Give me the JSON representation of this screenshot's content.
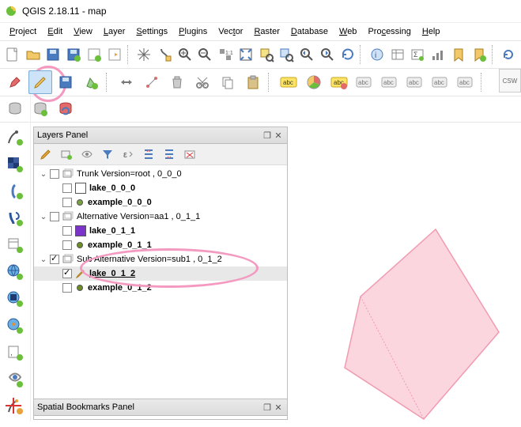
{
  "window": {
    "title": "QGIS 2.18.11 - map"
  },
  "menu": [
    {
      "label": "Project",
      "u": 0
    },
    {
      "label": "Edit",
      "u": 0
    },
    {
      "label": "View",
      "u": 0
    },
    {
      "label": "Layer",
      "u": 0
    },
    {
      "label": "Settings",
      "u": 0
    },
    {
      "label": "Plugins",
      "u": 0
    },
    {
      "label": "Vector",
      "u": 3
    },
    {
      "label": "Raster",
      "u": 0
    },
    {
      "label": "Database",
      "u": 0
    },
    {
      "label": "Web",
      "u": 0
    },
    {
      "label": "Processing",
      "u": 3
    },
    {
      "label": "Help",
      "u": 0
    }
  ],
  "panels": {
    "layers_title": "Layers Panel",
    "bookmarks_title": "Spatial Bookmarks Panel"
  },
  "layer_toolbar_icons": [
    "style",
    "add-group",
    "visibility",
    "filter",
    "expression",
    "expand-all",
    "collapse-all",
    "remove"
  ],
  "tree": {
    "groups": [
      {
        "name": "Trunk Version=root , 0_0_0",
        "checked": false,
        "layers": [
          {
            "name": "lake_0_0_0",
            "color": "#ffffff",
            "type": "poly",
            "checked": false
          },
          {
            "name": "example_0_0_0",
            "color": "#7aa040",
            "type": "point",
            "checked": false
          }
        ]
      },
      {
        "name": "Alternative Version=aa1 , 0_1_1",
        "checked": false,
        "layers": [
          {
            "name": "lake_0_1_1",
            "color": "#7b33c9",
            "type": "poly",
            "checked": false
          },
          {
            "name": "example_0_1_1",
            "color": "#6b8e23",
            "type": "point",
            "checked": false
          }
        ]
      },
      {
        "name": "Sub Alternative Version=sub1 , 0_1_2",
        "checked": true,
        "layers": [
          {
            "name": "lake_0_1_2",
            "color": "-editing-",
            "type": "poly",
            "checked": true,
            "editing": true,
            "selected": true
          },
          {
            "name": "example_0_1_2",
            "color": "#6b8e23",
            "type": "point",
            "checked": false
          }
        ]
      }
    ]
  },
  "csw": {
    "label": "CSW"
  },
  "label_toolbar": {
    "abc": "abc"
  }
}
